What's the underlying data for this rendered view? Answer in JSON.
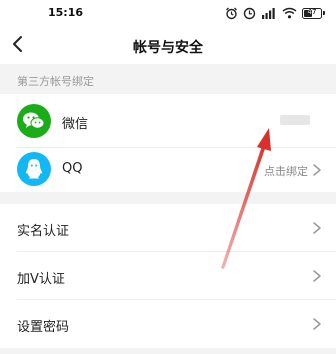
{
  "status": {
    "time": "15:16",
    "battery": "47"
  },
  "nav": {
    "title": "帐号与安全"
  },
  "section": {
    "title": "第三方帐号绑定"
  },
  "bindings": [
    {
      "label": "微信",
      "icon": "wechat-icon",
      "color": "#1aad19"
    },
    {
      "label": "QQ",
      "icon": "qq-icon",
      "color": "#12b7f5",
      "action": "点击绑定"
    }
  ],
  "menu": [
    {
      "label": "实名认证"
    },
    {
      "label": "加V认证"
    },
    {
      "label": "设置密码"
    }
  ],
  "annotation": {
    "arrow_color": "#d9302a"
  }
}
